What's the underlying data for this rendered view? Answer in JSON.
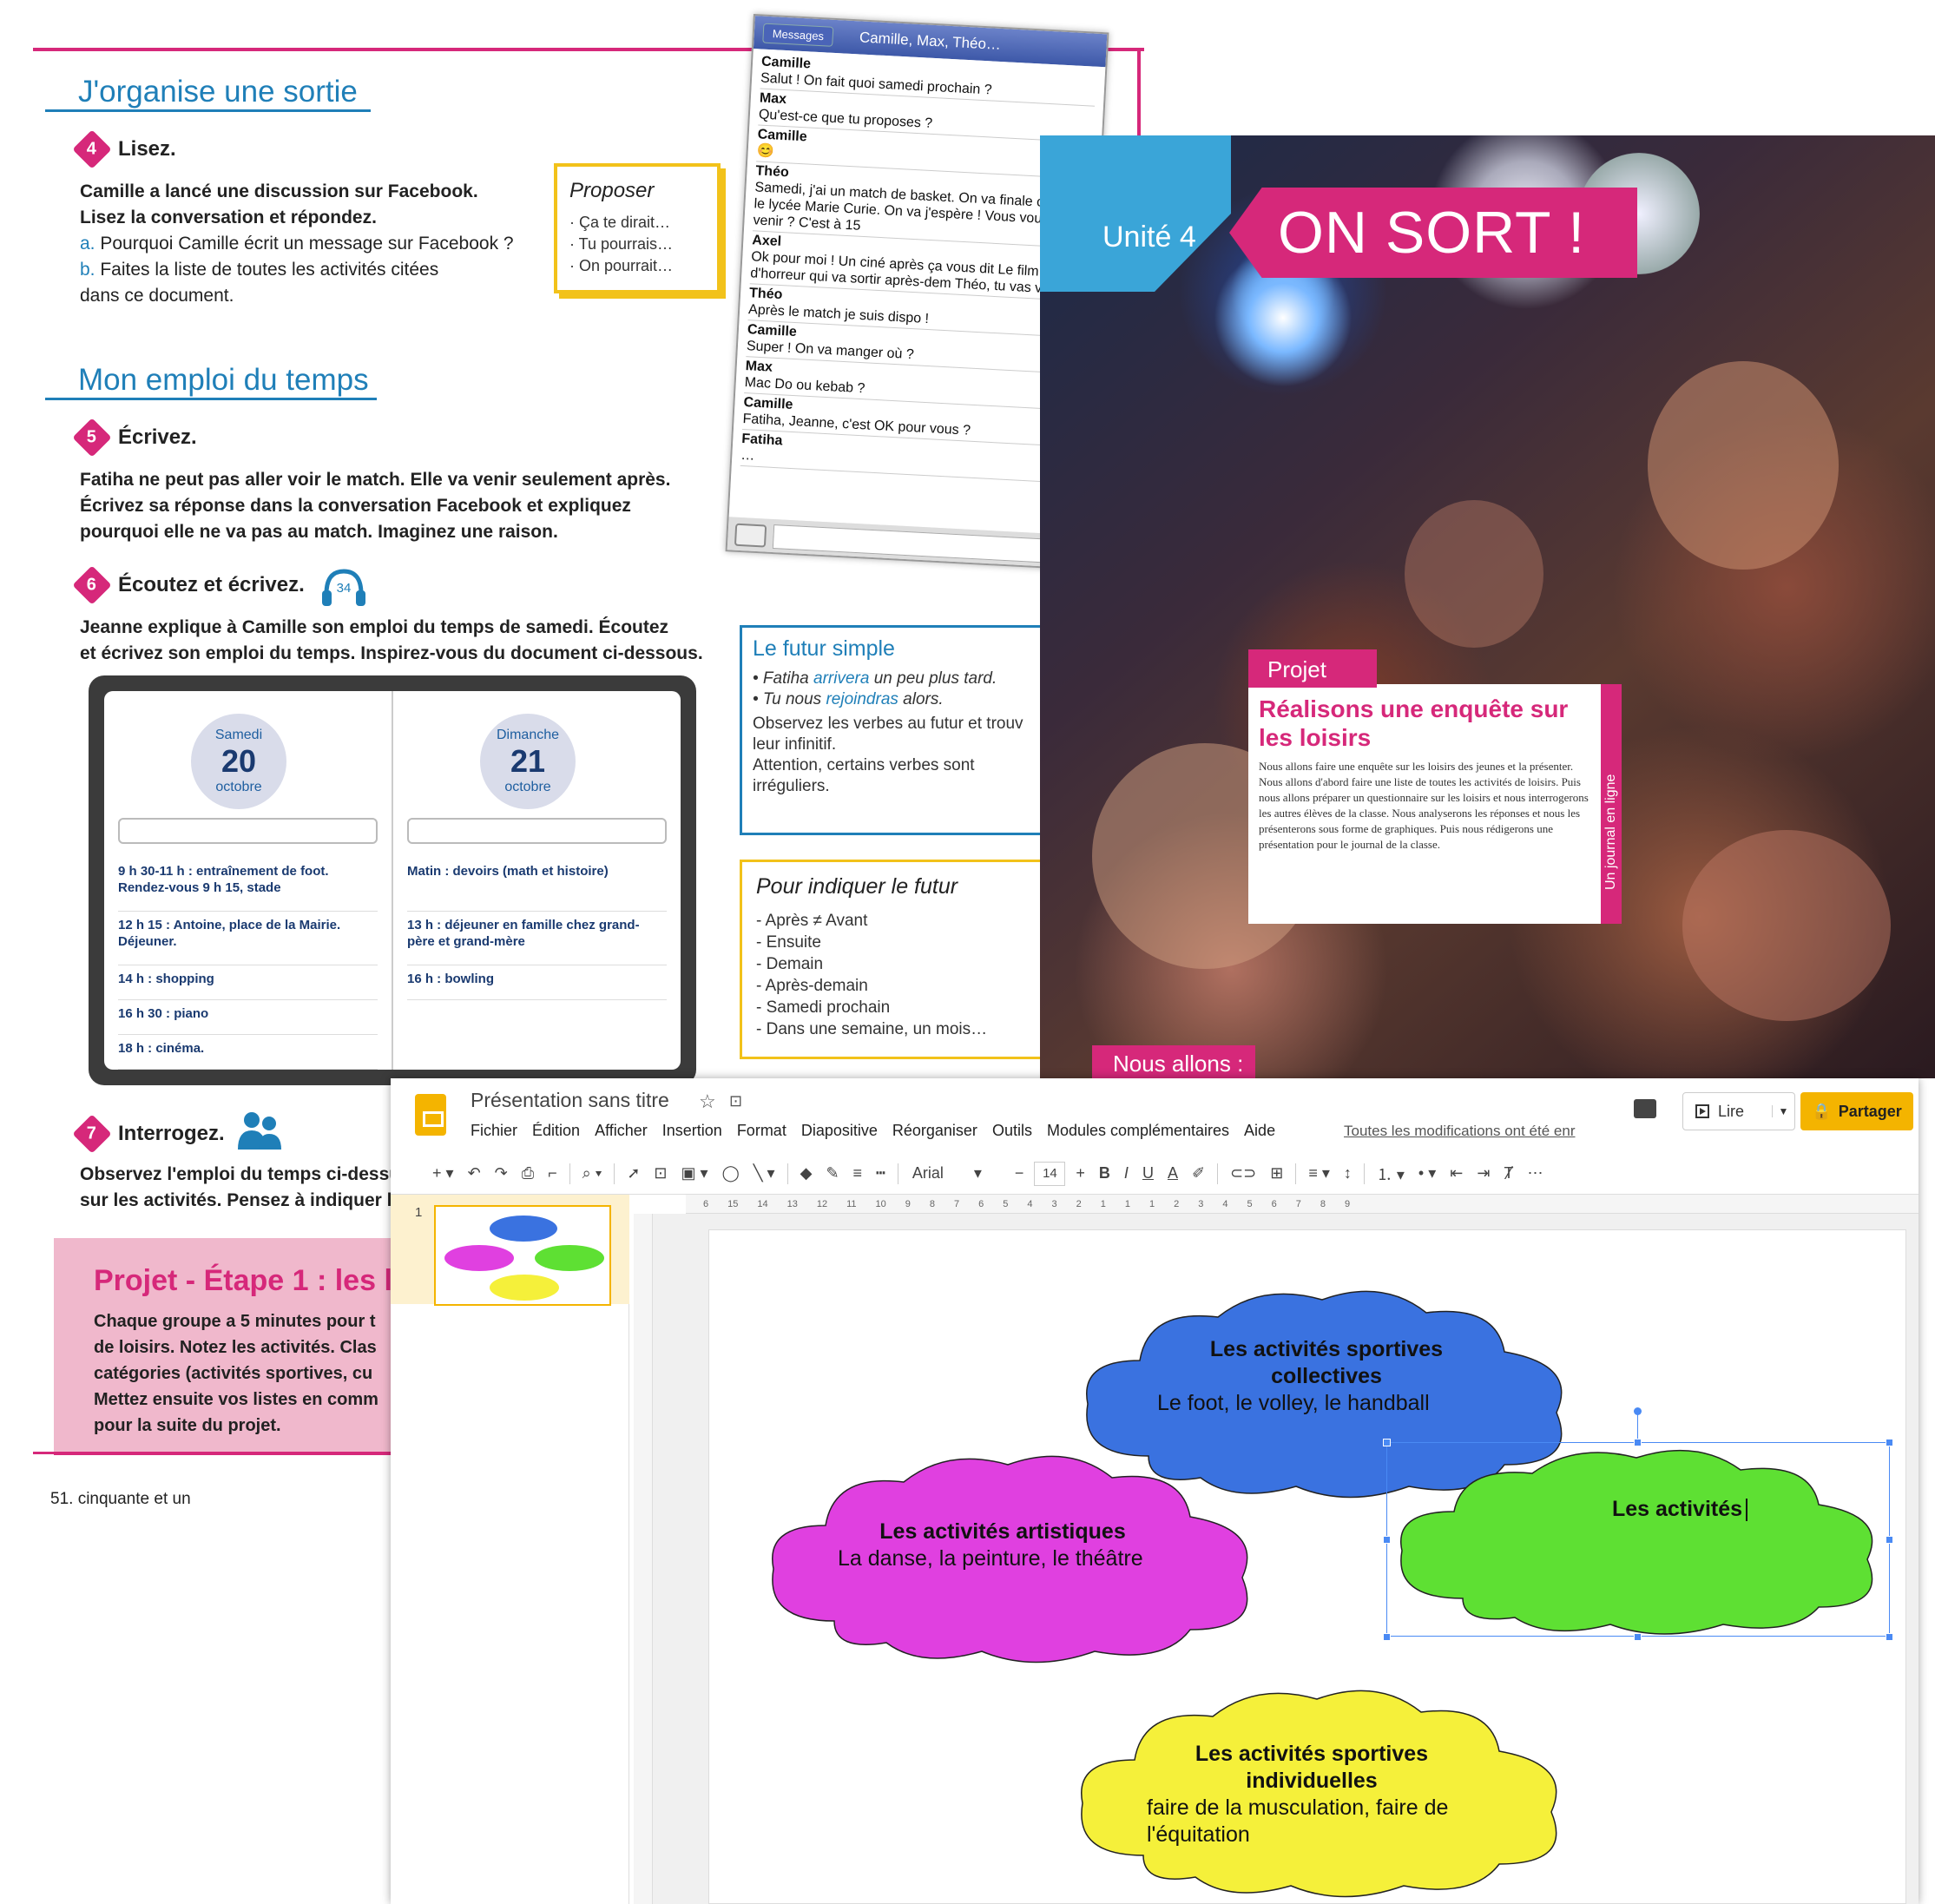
{
  "book": {
    "section1_title": "J'organise une sortie",
    "step4_num": "4",
    "step4_label": "Lisez.",
    "step4_intro1": "Camille a lancé une discussion sur Facebook.",
    "step4_intro2": "Lisez la conversation et répondez.",
    "step4_qa_letter": "a.",
    "step4_qa": " Pourquoi Camille écrit un message sur Facebook ?",
    "step4_qb_letter": "b.",
    "step4_qb": " Faites la liste de toutes les activités citées",
    "step4_qb2": "dans ce document.",
    "proposer_title": "Proposer",
    "proposer_items": [
      "· Ça te dirait…",
      "· Tu pourrais…",
      "· On pourrait…"
    ],
    "section2_title": "Mon emploi du temps",
    "step5_num": "5",
    "step5_label": "Écrivez.",
    "step5_text": [
      "Fatiha ne peut pas aller voir le match. Elle va venir seulement après.",
      "Écrivez sa réponse dans la conversation Facebook et expliquez",
      "pourquoi elle ne va pas au match. Imaginez une raison."
    ],
    "step6_num": "6",
    "step6_label": "Écoutez et écrivez.",
    "audio_track": "34",
    "step6_text": [
      "Jeanne explique à Camille son emploi du temps de samedi. Écoutez",
      "et écrivez son emploi du temps. Inspirez-vous du document ci-dessous."
    ],
    "agenda": {
      "left": {
        "day": "Samedi",
        "num": "20",
        "month": "octobre",
        "lines": [
          "9 h 30-11 h : entraînement de foot. Rendez-vous 9 h 15, stade",
          "12 h 15 : Antoine, place de la Mairie. Déjeuner.",
          "14 h : shopping",
          "16 h 30 : piano",
          "18 h : cinéma."
        ]
      },
      "right": {
        "day": "Dimanche",
        "num": "21",
        "month": "octobre",
        "lines": [
          "Matin : devoirs (math et histoire)",
          "13 h : déjeuner en famille chez grand-père et grand-mère",
          "16 h : bowling"
        ]
      }
    },
    "step7_num": "7",
    "step7_label": "Interrogez.",
    "step7_text": [
      "Observez l'emploi du temps ci-dessu",
      "sur les activités. Pensez à indiquer l"
    ],
    "projet_title": "Projet - Étape 1 : les loi",
    "projet_text": [
      "Chaque groupe a 5 minutes pour t",
      "de loisirs. Notez les activités. Clas",
      "catégories (activités sportives, cu",
      "Mettez ensuite vos listes en comm",
      "pour la suite du projet."
    ],
    "page_number": "51. cinquante et un",
    "futur_title": "Le futur simple",
    "futur_ex1_a": "• Fatiha ",
    "futur_ex1_b": "arrivera",
    "futur_ex1_c": " un peu plus tard.",
    "futur_ex2_a": "• Tu nous ",
    "futur_ex2_b": "rejoindras",
    "futur_ex2_c": " alors.",
    "futur_text": [
      "Observez les verbes au futur et trouv",
      "leur infinitif.",
      "Attention, certains verbes sont",
      "irréguliers."
    ],
    "indiquer_title": "Pour indiquer le futur",
    "indiquer_items": [
      "- Après ≠ Avant",
      "- Ensuite",
      "- Demain",
      "- Après-demain",
      "- Samedi prochain",
      "- Dans une semaine, un mois…"
    ]
  },
  "messages": {
    "tab": "Messages",
    "title": "Camille, Max, Théo…",
    "entries": [
      {
        "author": "Camille",
        "text": "Salut ! On fait quoi samedi prochain ?"
      },
      {
        "author": "Max",
        "text": "Qu'est-ce que tu proposes ?"
      },
      {
        "author": "Camille",
        "text": "😊"
      },
      {
        "author": "Théo",
        "text": "Samedi, j'ai un match de basket. On va finale contre le lycée Marie Curie. On va j'espère ! Vous voulez venir ? C'est à 15"
      },
      {
        "author": "Axel",
        "text": "Ok pour moi ! Un ciné après ça vous dit Le film d'horreur qui va sortir après-dem Théo, tu vas venir ?"
      },
      {
        "author": "Théo",
        "text": "Après le match je suis dispo !"
      },
      {
        "author": "Camille",
        "text": "Super ! On va manger où ?"
      },
      {
        "author": "Max",
        "text": "Mac Do ou kebab ?"
      },
      {
        "author": "Camille",
        "text": "Fatiha, Jeanne, c'est OK pour vous ?"
      },
      {
        "author": "Fatiha",
        "text": "…"
      }
    ]
  },
  "cover": {
    "unite": "Unité 4",
    "headline": "ON SORT !",
    "projet_tag": "Projet",
    "projet_title": "Réalisons une enquête sur les loisirs",
    "projet_text": "Nous allons faire une enquête sur les loisirs des jeunes et la présenter. Nous allons d'abord faire une liste de toutes les activités de loisirs. Puis nous allons préparer un questionnaire sur les loisirs et nous interrogerons les autres élèves de la classe. Nous analyserons les réponses et nous les présenterons sous forme de graphiques. Puis nous rédigerons une présentation pour le journal de la classe.",
    "vertical_label": "Un journal en ligne",
    "nous_allons": "Nous allons :"
  },
  "slides": {
    "doc_title": "Présentation sans titre",
    "menu": [
      "Fichier",
      "Édition",
      "Afficher",
      "Insertion",
      "Format",
      "Diapositive",
      "Réorganiser",
      "Outils",
      "Modules complémentaires",
      "Aide"
    ],
    "saved_status": "Toutes les modifications ont été enr",
    "lire": "Lire",
    "partager": "Partager",
    "font": "Arial",
    "font_size": "14",
    "slide_number": "1",
    "ruler_marks": [
      "6",
      "15",
      "14",
      "13",
      "12",
      "11",
      "10",
      "9",
      "8",
      "7",
      "6",
      "5",
      "4",
      "3",
      "2",
      "1",
      "1",
      "1",
      "2",
      "3",
      "4",
      "5",
      "6",
      "7",
      "8",
      "9"
    ],
    "clouds": [
      {
        "title": "Les activités sportives collectives",
        "body": "Le foot, le volley, le handball",
        "color": "#3a72e0"
      },
      {
        "title": "Les activités artistiques",
        "body": "La danse, la peinture, le théâtre",
        "color": "#e040e0"
      },
      {
        "title": "Les activités",
        "body": "",
        "color": "#5ee033"
      },
      {
        "title": "Les activités sportives individuelles",
        "body": "faire de la musculation, faire de l'équitation",
        "color": "#f5f03a"
      }
    ]
  }
}
